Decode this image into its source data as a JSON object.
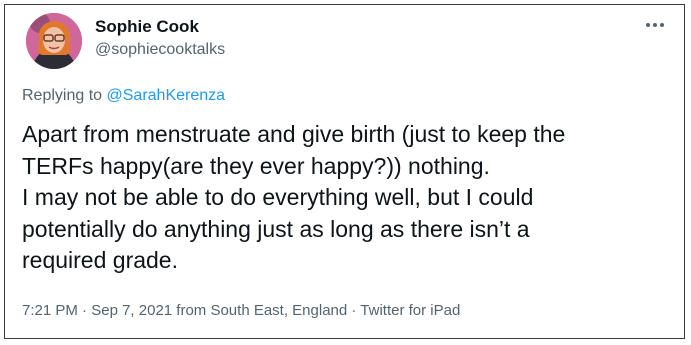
{
  "author": {
    "name": "Sophie Cook",
    "handle": "@sophiecooktalks"
  },
  "reply": {
    "prefix": "Replying to ",
    "target": "@SarahKerenza"
  },
  "tweet": {
    "lines": [
      "Apart from menstruate and give birth (just to keep the",
      "TERFs happy(are they ever happy?)) nothing.",
      "I may not be able to do everything well, but I could",
      "potentially do anything just as long as there isn’t a",
      "required grade."
    ]
  },
  "meta": {
    "time": "7:21 PM",
    "sep1": " · ",
    "date": "Sep 7, 2021",
    "location": " from South East, England",
    "sep2": " · ",
    "source": "Twitter for iPad"
  },
  "icons": {
    "more": "more-options-icon"
  },
  "colors": {
    "link": "#1d9bf0",
    "secondary_text": "#536471",
    "primary_text": "#0f1419"
  }
}
